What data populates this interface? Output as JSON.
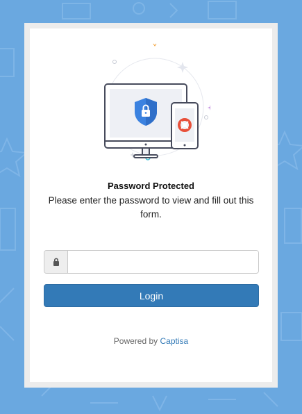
{
  "colors": {
    "background": "#6aa8e0",
    "primary_button": "#337ab7",
    "shield": "#3b82e0"
  },
  "form": {
    "title": "Password Protected",
    "subtitle": "Please enter the password to view and fill out this form.",
    "password_placeholder": "",
    "lock_icon": "lock-icon",
    "login_label": "Login"
  },
  "footer": {
    "powered_prefix": "Powered by",
    "brand": "Captisa"
  }
}
